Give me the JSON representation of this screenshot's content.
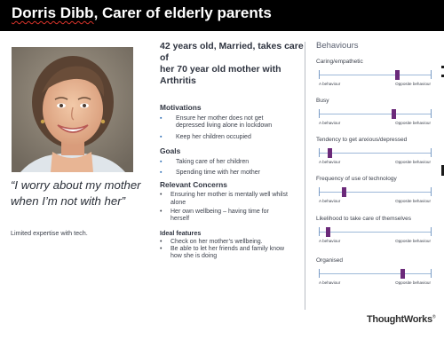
{
  "header": {
    "name": "Dorris Dibb",
    "role": ", Carer of elderly parents"
  },
  "profile": {
    "quote_line1": "“I worry about my mother",
    "quote_line2": "when I’m not with her”",
    "note": "Limited expertise with tech."
  },
  "summary": {
    "line1": "42 years old, Married, takes care of",
    "line2": "her 70 year old mother with Arthritis"
  },
  "motivations": {
    "title": "Motivations",
    "items": [
      "Ensure her mother does not get",
      "depressed living alone in lockdown",
      "Keep her children occupied"
    ]
  },
  "goals": {
    "title": "Goals",
    "items": [
      "Taking care of her children",
      "Spending time with her mother"
    ]
  },
  "concerns": {
    "title": "Relevant Concerns",
    "items": [
      "Ensuring her mother is mentally well whilst",
      "alone",
      "Her own wellbeing – having time for",
      "herself"
    ]
  },
  "ideal": {
    "title": "Ideal features",
    "items": [
      "Check on her mother’s wellbeing.",
      "Be able to let her friends and family know",
      "how she is doing"
    ]
  },
  "behaviours": {
    "title": "Behaviours",
    "low_label": "A behaviour",
    "high_label": "Opposite behaviour",
    "accent": "#6b2a7a",
    "items": [
      {
        "name": "Caring/empathetic",
        "level": 0.7
      },
      {
        "name": "Busy",
        "level": 0.67
      },
      {
        "name": "Tendency to get anxious/depressed",
        "level": 0.1
      },
      {
        "name": "Frequency of use of technology",
        "level": 0.23
      },
      {
        "name": "Likelihood to take care of themselves",
        "level": 0.08
      },
      {
        "name": "Organised",
        "level": 0.75
      }
    ]
  },
  "brand": {
    "logo": "ThoughtWorks",
    "mark": "®"
  }
}
